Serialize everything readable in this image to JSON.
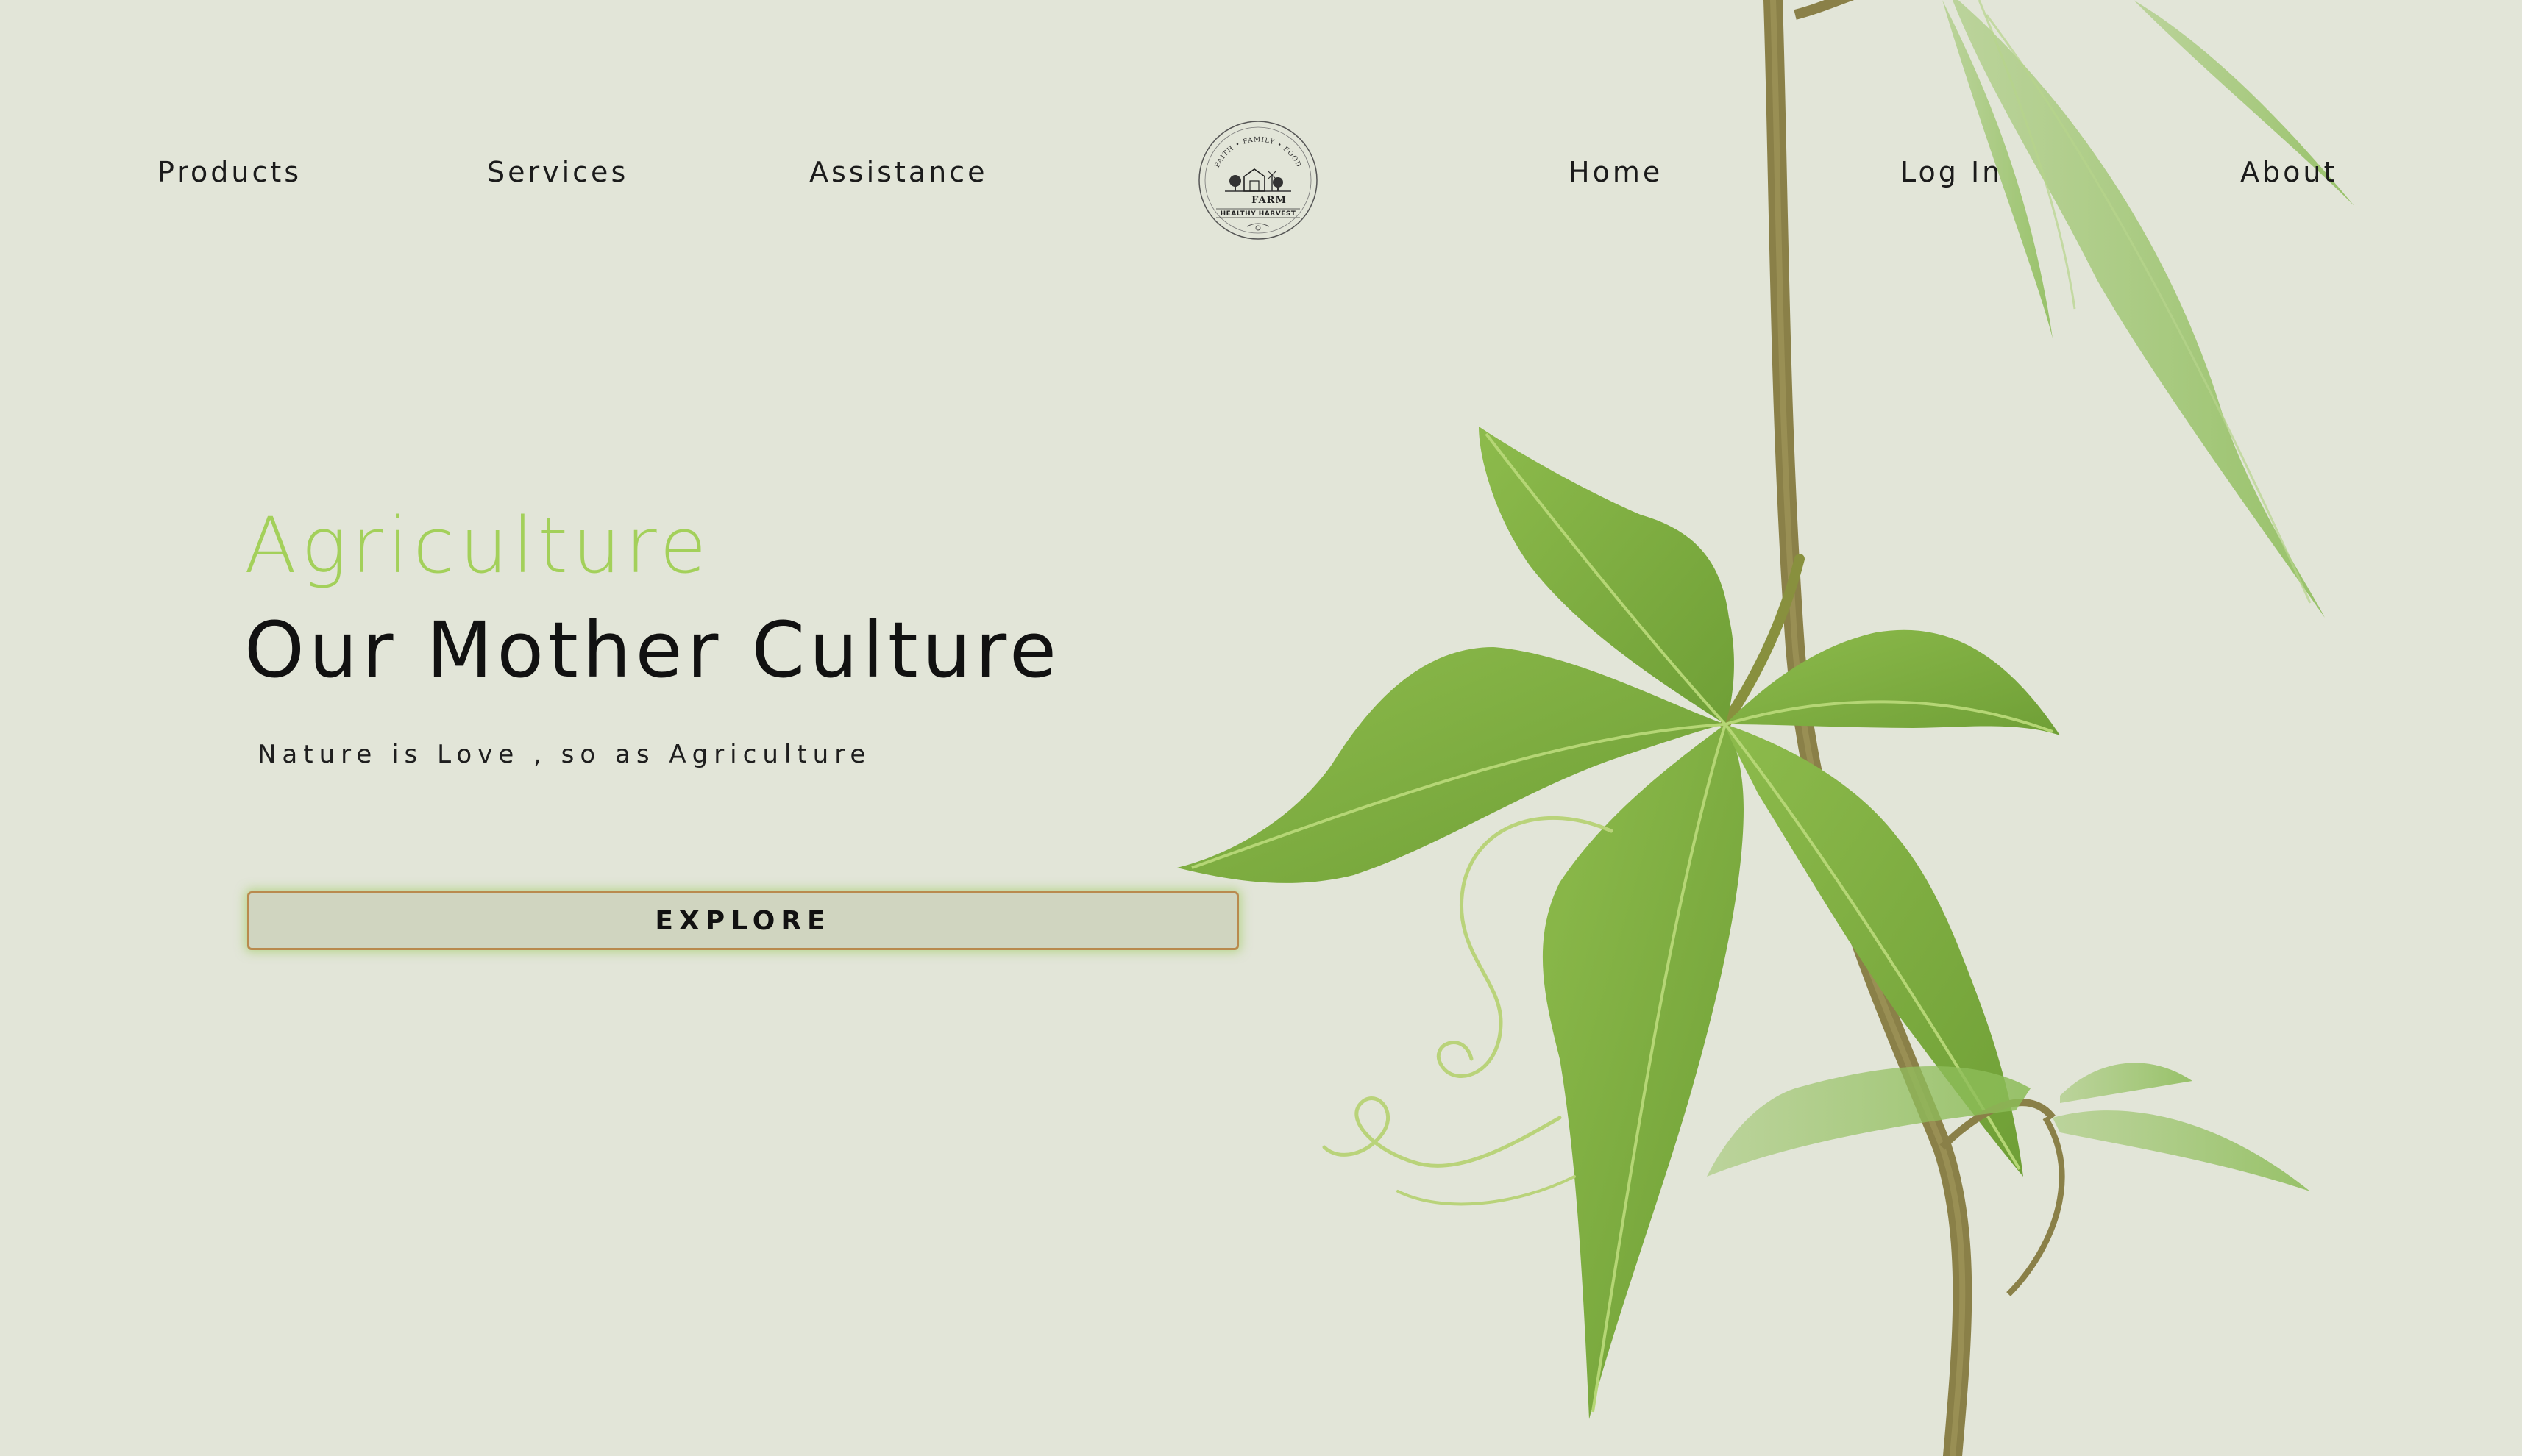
{
  "nav": {
    "left": [
      "Products",
      "Services",
      "Assistance"
    ],
    "right": [
      "Home",
      "Log In",
      "About"
    ]
  },
  "logo": {
    "arc_text": "FAITH • FAMILY • FOOD",
    "farm_text": "FARM",
    "banner_text": "HEALTHY HARVEST"
  },
  "hero": {
    "kicker": "Agriculture",
    "title": "Our Mother Culture",
    "subtitle": "Nature is Love , so as Agriculture",
    "button_label": "EXPLORE"
  },
  "colors": {
    "background": "#e2e5d8",
    "accent_green": "#a3d05a",
    "button_bg": "#d0d5c0",
    "button_border": "#b98a4e",
    "leaf": "#7fae3e"
  }
}
